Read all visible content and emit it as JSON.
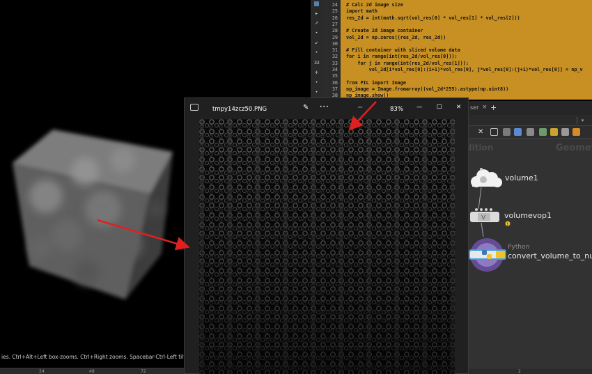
{
  "viewport": {
    "status_text": "ies. Ctrl+Alt+Left box-zooms. Ctrl+Right zooms. Spacebar-Ctrl-Left tilts. Hold L for alterna"
  },
  "ruler": {
    "ticks": [
      "24",
      "48",
      "72",
      "2"
    ]
  },
  "editor": {
    "lines": [
      {
        "n": "24",
        "code": "# Calc 2d image size"
      },
      {
        "n": "25",
        "code": "import math"
      },
      {
        "n": "26",
        "code": "res_2d = int(math.sqrt(vol_res[0] * vol_res[1] * vol_res[2]))"
      },
      {
        "n": "27",
        "code": ""
      },
      {
        "n": "28",
        "code": "# Create 2d image container"
      },
      {
        "n": "29",
        "code": "vol_2d = np.zeros((res_2d, res_2d))"
      },
      {
        "n": "30",
        "code": ""
      },
      {
        "n": "31",
        "code": "# Fill container with sliced volume data"
      },
      {
        "n": "32",
        "code": "for i in range(int(res_2d/vol_res[0])):"
      },
      {
        "n": "33",
        "code": "    for j in range(int(res_2d/vol_res[1])):"
      },
      {
        "n": "34",
        "code": "        vol_2d[i*vol_res[0]:(i+1)*vol_res[0], j*vol_res[0]:(j+1)*vol_res[0]] = np_v"
      },
      {
        "n": "35",
        "code": ""
      },
      {
        "n": "36",
        "code": "from PIL import Image"
      },
      {
        "n": "37",
        "code": "np_image = Image.fromarray((vol_2d*255).astype(np.uint8))"
      },
      {
        "n": "38",
        "code": "np_image.show()"
      }
    ],
    "toolbar_icon_32": "32"
  },
  "viewer": {
    "title": "tmpy14zcz50.PNG",
    "zoom": "83%",
    "more": "•••",
    "minimize": "—",
    "maximize": "☐",
    "close": "✕"
  },
  "network": {
    "tab_fragment": "ser",
    "tab_close": "×",
    "tab_add": "+",
    "ghost_left": "dition",
    "ghost_right": "Geomet",
    "nodes": [
      {
        "label": "volume1"
      },
      {
        "label": "volumevop1"
      },
      {
        "type": "Python",
        "label": "convert_volume_to_num"
      }
    ]
  },
  "colors": {
    "code_bg": "#c89023",
    "viewer_bg": "#202020",
    "network_bg": "#323232",
    "arrow": "#e02020"
  }
}
